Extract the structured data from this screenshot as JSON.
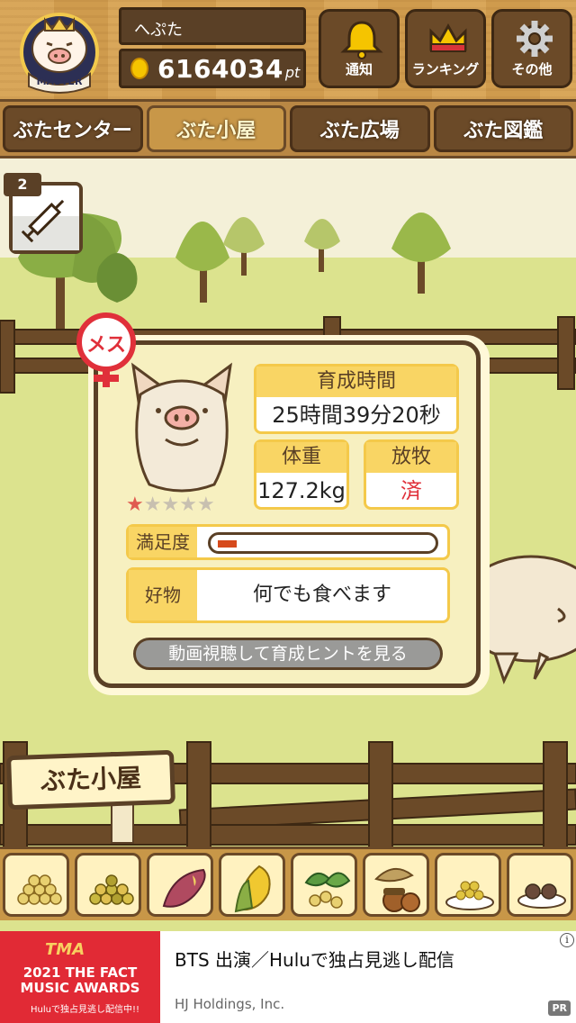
{
  "user": {
    "name": "へぷた",
    "points": "6164034",
    "points_unit": "pt",
    "rank_badge": "MASTER"
  },
  "header_buttons": [
    {
      "label": "通知",
      "icon": "bell-icon"
    },
    {
      "label": "ランキング",
      "icon": "crown-icon"
    },
    {
      "label": "その他",
      "icon": "gear-icon"
    }
  ],
  "nav": {
    "tabs": [
      "ぶたセンター",
      "ぶた小屋",
      "ぶた広場",
      "ぶた図鑑"
    ],
    "active": "ぶた小屋"
  },
  "syringe": {
    "count": "2"
  },
  "pig": {
    "gender_label": "メス",
    "stars_filled": 1,
    "stars_total": 5,
    "growth_time_label": "育成時間",
    "growth_time_value": "25時間39分20秒",
    "weight_label": "体重",
    "weight_value": "127.2kg",
    "grazing_label": "放牧",
    "grazing_value": "済",
    "satisfaction_label": "満足度",
    "satisfaction_level": 0.09,
    "favorite_label": "好物",
    "favorite_value": "何でも食べます",
    "hint_button": "動画視聴して育成ヒントを見る"
  },
  "sign_label": "ぶた小屋",
  "food_items": [
    "soybeans-icon",
    "mixed-beans-icon",
    "sweet-potato-icon",
    "corn-icon",
    "greens-icon",
    "acorn-icon",
    "grain-plate-icon",
    "truffle-plate-icon"
  ],
  "ad": {
    "image_brand": "TMA",
    "image_headline": "2021 THE FACT MUSIC AWARDS",
    "image_sub": "Huluで独占見逃し配信中!!",
    "title": "BTS 出演／Huluで独占見逃し配信",
    "company": "HJ Holdings, Inc.",
    "badge": "PR",
    "info": "i"
  },
  "colors": {
    "wood_dark": "#5a4026",
    "wood_light": "#d9a75a",
    "accent_yellow": "#f9d564",
    "female_red": "#e0303a",
    "ad_red": "#e12a35"
  }
}
